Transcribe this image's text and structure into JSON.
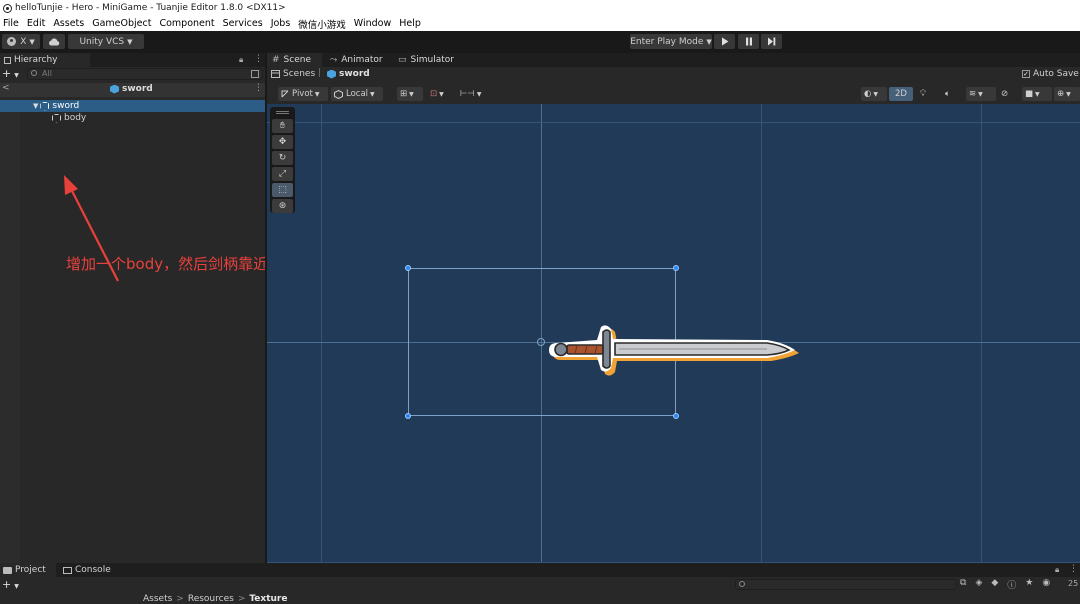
{
  "window": {
    "title": "helloTunjie - Hero - MiniGame - Tuanjie Editor 1.8.0 <DX11>"
  },
  "menu": [
    "File",
    "Edit",
    "Assets",
    "GameObject",
    "Component",
    "Services",
    "Jobs",
    "微信小游戏",
    "Window",
    "Help"
  ],
  "toolbar": {
    "account_label": "X",
    "vcs_label": "Unity VCS",
    "play_mode_label": "Enter Play Mode",
    "play_icon": "play-icon",
    "pause_icon": "pause-icon",
    "step_icon": "step-icon"
  },
  "hierarchy": {
    "tab_label": "Hierarchy",
    "search_placeholder": "All",
    "prefab_title": "sword",
    "items": [
      {
        "label": "sword",
        "selected": true
      },
      {
        "label": "body",
        "selected": false
      }
    ]
  },
  "annotation": {
    "text": "增加一个body，然后剑柄靠近居中原点",
    "color": "#e8413b"
  },
  "scene": {
    "tabs": [
      "Scene",
      "Animator",
      "Simulator"
    ],
    "breadcrumb": [
      "Scenes",
      "sword"
    ],
    "auto_save_label": "Auto Save",
    "auto_save_checked": true,
    "pivot_label": "Pivot",
    "local_label": "Local",
    "mode_2d_label": "2D",
    "viewport_color": "#203a58"
  },
  "project": {
    "tabs": [
      "Project",
      "Console"
    ],
    "path": [
      "Assets",
      "Resources",
      "Texture"
    ],
    "hidden_count": "25"
  }
}
